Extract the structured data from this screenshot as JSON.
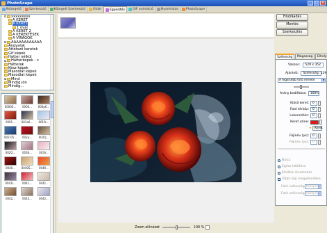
{
  "window": {
    "title": "PhotoScape",
    "min": "_",
    "max": "□",
    "close": "x"
  },
  "tabs": [
    {
      "label": "Nézegető",
      "color": "#6aa8e8"
    },
    {
      "label": "Szerkesztő",
      "color": "#e87b5a"
    },
    {
      "label": "Kötegelt Szerkesztő",
      "color": "#58b26a"
    },
    {
      "label": "Oldal",
      "color": "#e0b84a"
    },
    {
      "label": "Egyesítés",
      "color": "#c56ae0"
    },
    {
      "label": "GIF animáció",
      "color": "#4ac8c8"
    },
    {
      "label": "Nyomtatás",
      "color": "#9a9a9a"
    },
    {
      "label": "PhotoScape",
      "color": "#f08a3a"
    }
  ],
  "tree": [
    {
      "label": "xxxxxxxxx",
      "indent": 4,
      "exp": "-"
    },
    {
      "label": "A  KERET",
      "indent": 10,
      "exp": ""
    },
    {
      "label": "A KERET",
      "indent": 10,
      "exp": "",
      "selected": true
    },
    {
      "label": "1 oval",
      "indent": 16,
      "exp": ""
    },
    {
      "label": "A KERET 2",
      "indent": 10,
      "exp": ""
    },
    {
      "label": "A KEREKTÉSEK",
      "indent": 10,
      "exp": ""
    },
    {
      "label": "A VIRÁGOK",
      "indent": 10,
      "exp": ""
    },
    {
      "label": "AAAAAAAAAAAA",
      "indent": 4,
      "exp": "+"
    },
    {
      "label": "Angyalok",
      "indent": 4,
      "exp": ""
    },
    {
      "label": "Áttetsző keretek",
      "indent": 4,
      "exp": ""
    },
    {
      "label": "Gif képek",
      "indent": 4,
      "exp": ""
    },
    {
      "label": "Hatter nélkül",
      "indent": 4,
      "exp": ""
    },
    {
      "label": "Háttérképek - c",
      "indent": 4,
      "exp": "+"
    },
    {
      "label": "Hátterek",
      "indent": 4,
      "exp": ""
    },
    {
      "label": "Kész képek",
      "indent": 4,
      "exp": ""
    },
    {
      "label": "Másodlat képek",
      "indent": 4,
      "exp": ""
    },
    {
      "label": "Másodlat képek",
      "indent": 4,
      "exp": ""
    },
    {
      "label": "Mind",
      "indent": 4,
      "exp": "+"
    },
    {
      "label": "Mindig jön",
      "indent": 4,
      "exp": ""
    },
    {
      "label": "Mindig...",
      "indent": 4,
      "exp": ""
    }
  ],
  "thumbnails": [
    {
      "name": "00000...",
      "c1": "#d9c6a8",
      "c2": "#8a6a4a"
    },
    {
      "name": "0000...",
      "c1": "#c9a9a0",
      "c2": "#6a3a30"
    },
    {
      "name": "000p6...",
      "c1": "#3a2a20",
      "c2": "#b08060"
    },
    {
      "name": "0001...",
      "c1": "#e85a40",
      "c2": "#7a1a10"
    },
    {
      "name": "001a0...",
      "c1": "#2a3050",
      "c2": "#d0c0a0"
    },
    {
      "name": "001fL...",
      "c1": "#a0c8e8",
      "c2": "#f0e8f0"
    },
    {
      "name": "002-05...",
      "c1": "#4a7ab0",
      "c2": "#1a3a70"
    },
    {
      "name": "002p...",
      "c1": "#c01020",
      "c2": "#701010"
    },
    {
      "name": "002Q...",
      "c1": "#605040",
      "c2": "#d8c0a0"
    },
    {
      "name": "002Q...",
      "c1": "#101820",
      "c2": "#c0a0a0"
    },
    {
      "name": "0036...",
      "c1": "#e0d0d8",
      "c2": "#a07080"
    },
    {
      "name": "003V...",
      "c1": "#e8b0c0",
      "c2": "#f8f0f0"
    },
    {
      "name": "0040...",
      "c1": "#a01010",
      "c2": "#300808"
    },
    {
      "name": "0040S...",
      "c1": "#c8a070",
      "c2": "#f0e0c0"
    },
    {
      "name": "0040...",
      "c1": "#e84a30",
      "c2": "#f0a040"
    },
    {
      "name": "0041I...",
      "c1": "#3a3040",
      "c2": "#9a8aa0"
    },
    {
      "name": "0041...",
      "c1": "#d02030",
      "c2": "#f0c0c0"
    },
    {
      "name": "0041...",
      "c1": "#f0e8e0",
      "c2": "#c8b8a8"
    },
    {
      "name": "0042...",
      "c1": "#d0b090",
      "c2": "#705030"
    },
    {
      "name": "0042...",
      "c1": "#e0d8d0",
      "c2": "#8a7060"
    },
    {
      "name": "0042...",
      "c1": "#e8e8f0",
      "c2": "#a0a0c0"
    }
  ],
  "right": {
    "save_as_btn": "Hozzáadás",
    "save_btn": "Mentés",
    "edit_btn": "Szerkesztés",
    "tabs": [
      "Szélesség",
      "Magasság",
      "Elhelyezés"
    ],
    "size_label": "Vászon:",
    "size_value": "529 x 352",
    "recommend_label": "Ajánlott:",
    "recommend_value": "Szélesség: 529",
    "resize_dropdown": "A legkisebb fotó mérete",
    "ratio_label": "Arány beállítása:",
    "ratio_value": "100%",
    "outer_border_label": "Külső keret:",
    "outer_border_value": "0",
    "photo_spacing_label": "Fotó térköz:",
    "photo_spacing_value": "0",
    "round_label": "Lekerekítés:",
    "round_value": "0",
    "border_color_label": "Keret színe:",
    "border_color": "#e01818",
    "frame_label": "Keret",
    "file_size_label": "Fájlnév (px):",
    "file_size_value": "0",
    "file_count_label": "Fájlnév (px):",
    "file_count_value": "0",
    "option_none": "Nincs",
    "option_fill": "Egész kitöltése",
    "option_fit": "Kitöltés illeszkedés",
    "checkbox_label": "Többi kép megjelenítése",
    "width_label": "Fotó szélessége:",
    "width_dd": "Középre",
    "height_label": "Fotó szélessége:",
    "height_dd": "Középre"
  },
  "bottom": {
    "zoom_label": "Zoom előnézet",
    "zoom_value": "100 %"
  }
}
